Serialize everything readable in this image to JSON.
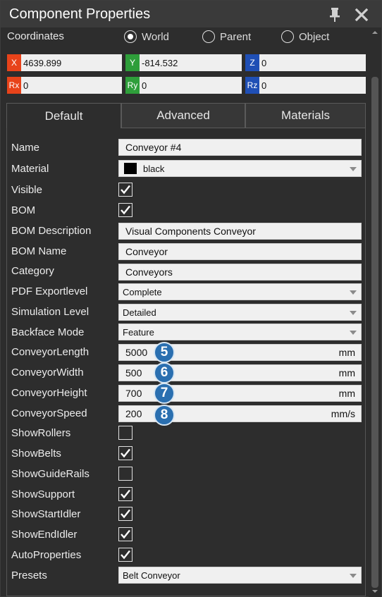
{
  "window": {
    "title": "Component Properties"
  },
  "coordinates": {
    "label": "Coordinates",
    "options": [
      "World",
      "Parent",
      "Object"
    ],
    "selected": "World",
    "fields": [
      {
        "tag": "X",
        "value": "4639.899",
        "color": "#e8431a"
      },
      {
        "tag": "Y",
        "value": "-814.532",
        "color": "#2e9e3a"
      },
      {
        "tag": "Z",
        "value": "0",
        "color": "#1f4fb5"
      },
      {
        "tag": "Rx",
        "value": "0",
        "color": "#e8431a"
      },
      {
        "tag": "Ry",
        "value": "0",
        "color": "#2e9e3a"
      },
      {
        "tag": "Rz",
        "value": "0",
        "color": "#1f4fb5"
      }
    ]
  },
  "tabs": [
    "Default",
    "Advanced",
    "Materials"
  ],
  "properties": {
    "name": {
      "label": "Name",
      "value": "Conveyor #4"
    },
    "material": {
      "label": "Material",
      "value": "black",
      "swatch": "#000000"
    },
    "visible": {
      "label": "Visible",
      "checked": true
    },
    "bom": {
      "label": "BOM",
      "checked": true
    },
    "bom_description": {
      "label": "BOM Description",
      "value": "Visual Components Conveyor"
    },
    "bom_name": {
      "label": "BOM Name",
      "value": "Conveyor"
    },
    "category": {
      "label": "Category",
      "value": "Conveyors"
    },
    "pdf_exportlevel": {
      "label": "PDF Exportlevel",
      "value": "Complete"
    },
    "simulation_level": {
      "label": "Simulation Level",
      "value": "Detailed"
    },
    "backface_mode": {
      "label": "Backface Mode",
      "value": "Feature"
    },
    "conveyor_length": {
      "label": "ConveyorLength",
      "value": "5000",
      "unit": "mm",
      "badge": "5"
    },
    "conveyor_width": {
      "label": "ConveyorWidth",
      "value": "500",
      "unit": "mm",
      "badge": "6"
    },
    "conveyor_height": {
      "label": "ConveyorHeight",
      "value": "700",
      "unit": "mm",
      "badge": "7"
    },
    "conveyor_speed": {
      "label": "ConveyorSpeed",
      "value": "200",
      "unit": "mm/s",
      "badge": "8"
    },
    "show_rollers": {
      "label": "ShowRollers",
      "checked": false
    },
    "show_belts": {
      "label": "ShowBelts",
      "checked": true
    },
    "show_guide_rails": {
      "label": "ShowGuideRails",
      "checked": false
    },
    "show_support": {
      "label": "ShowSupport",
      "checked": true
    },
    "show_start_idler": {
      "label": "ShowStartIdler",
      "checked": true
    },
    "show_end_idler": {
      "label": "ShowEndIdler",
      "checked": true
    },
    "auto_properties": {
      "label": "AutoProperties",
      "checked": true
    },
    "presets": {
      "label": "Presets",
      "value": "Belt Conveyor"
    }
  },
  "icons": {
    "pin": "pin-icon",
    "close": "close-icon",
    "dropdown": "chevron-down-icon",
    "check": "checkmark-icon"
  }
}
